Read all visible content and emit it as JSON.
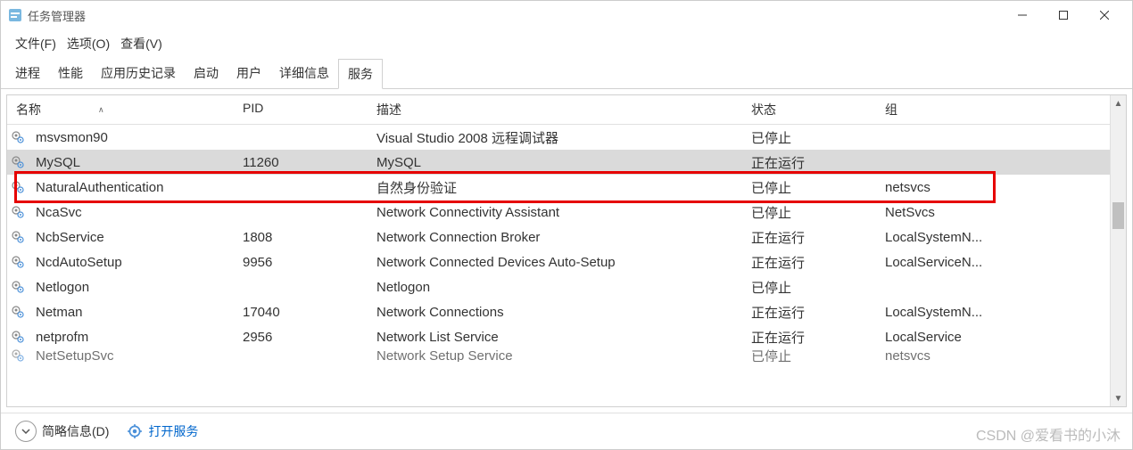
{
  "window": {
    "title": "任务管理器"
  },
  "menubar": {
    "file": "文件(F)",
    "options": "选项(O)",
    "view": "查看(V)"
  },
  "tabs": [
    "进程",
    "性能",
    "应用历史记录",
    "启动",
    "用户",
    "详细信息",
    "服务"
  ],
  "active_tab_index": 6,
  "columns": {
    "name": "名称",
    "pid": "PID",
    "desc": "描述",
    "status": "状态",
    "group": "组"
  },
  "services": [
    {
      "name": "msvsmon90",
      "pid": "",
      "desc": "Visual Studio 2008 远程调试器",
      "status": "已停止",
      "group": ""
    },
    {
      "name": "MySQL",
      "pid": "11260",
      "desc": "MySQL",
      "status": "正在运行",
      "group": "",
      "highlighted": true
    },
    {
      "name": "NaturalAuthentication",
      "pid": "",
      "desc": "自然身份验证",
      "status": "已停止",
      "group": "netsvcs"
    },
    {
      "name": "NcaSvc",
      "pid": "",
      "desc": "Network Connectivity Assistant",
      "status": "已停止",
      "group": "NetSvcs"
    },
    {
      "name": "NcbService",
      "pid": "1808",
      "desc": "Network Connection Broker",
      "status": "正在运行",
      "group": "LocalSystemN..."
    },
    {
      "name": "NcdAutoSetup",
      "pid": "9956",
      "desc": "Network Connected Devices Auto-Setup",
      "status": "正在运行",
      "group": "LocalServiceN..."
    },
    {
      "name": "Netlogon",
      "pid": "",
      "desc": "Netlogon",
      "status": "已停止",
      "group": ""
    },
    {
      "name": "Netman",
      "pid": "17040",
      "desc": "Network Connections",
      "status": "正在运行",
      "group": "LocalSystemN..."
    },
    {
      "name": "netprofm",
      "pid": "2956",
      "desc": "Network List Service",
      "status": "正在运行",
      "group": "LocalService"
    },
    {
      "name": "NetSetupSvc",
      "pid": "",
      "desc": "Network Setup Service",
      "status": "已停止",
      "group": "netsvcs"
    }
  ],
  "footer": {
    "less_details": "简略信息(D)",
    "open_services": "打开服务"
  },
  "watermark": "CSDN @爱看书的小沐"
}
